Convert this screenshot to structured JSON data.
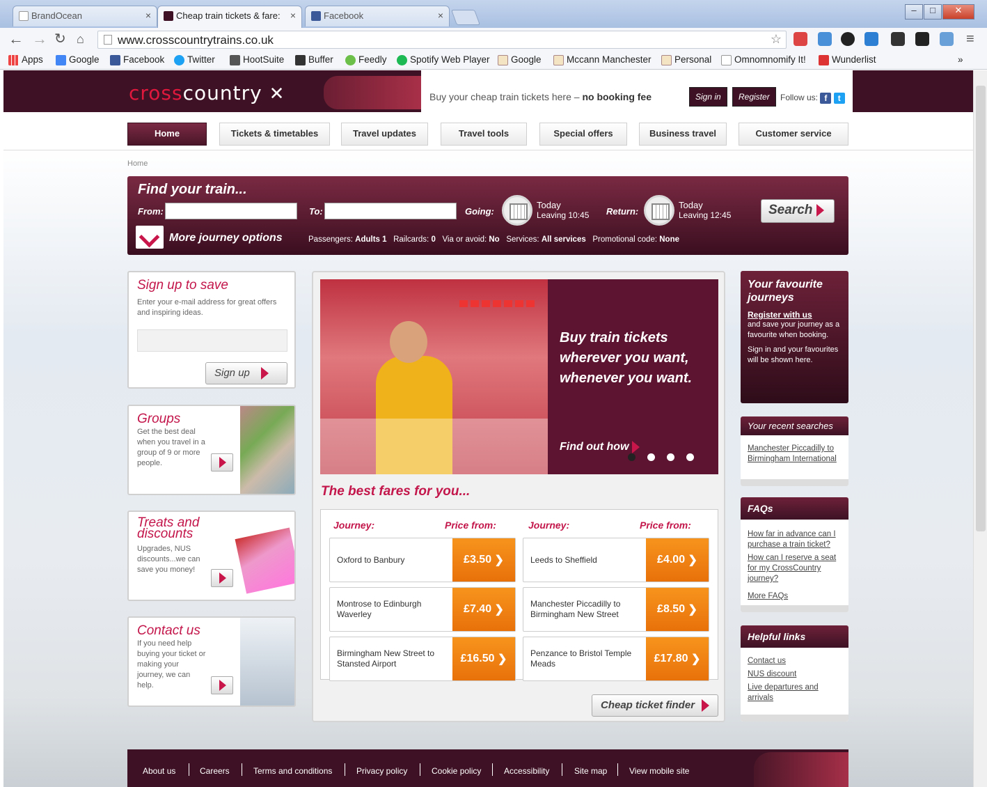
{
  "browser": {
    "tabs": [
      {
        "label": "BrandOcean"
      },
      {
        "label": "Cheap train tickets & fare:"
      },
      {
        "label": "Facebook"
      }
    ],
    "url": "www.crosscountrytrains.co.uk",
    "bookmarks": [
      "Apps",
      "Google",
      "Facebook",
      "Twitter",
      "HootSuite",
      "Buffer",
      "Feedly",
      "Spotify Web Player",
      "Google",
      "Mccann Manchester",
      "Personal",
      "Omnomnomify It!",
      "Wunderlist"
    ],
    "bookmarks_more": "»",
    "window_buttons": [
      "–",
      "□",
      "✕"
    ]
  },
  "header": {
    "logo_part1": "cross",
    "logo_part2": "country",
    "tagline_prefix": "Buy your cheap train tickets here –",
    "tagline_bold": "no booking fee",
    "sign_in": "Sign in",
    "register": "Register",
    "follow_us": "Follow us:"
  },
  "nav": [
    "Home",
    "Tickets & timetables",
    "Travel updates",
    "Travel tools",
    "Special offers",
    "Business travel",
    "Customer service"
  ],
  "breadcrumb": "Home",
  "finder": {
    "title": "Find your train...",
    "from_label": "From:",
    "to_label": "To:",
    "going_label": "Going:",
    "going_day": "Today",
    "going_time": "Leaving 10:45",
    "return_label": "Return:",
    "return_day": "Today",
    "return_time": "Leaving 12:45",
    "search": "Search",
    "more_options": "More journey options",
    "options": [
      {
        "label": "Passengers:",
        "value": "Adults 1"
      },
      {
        "label": "Railcards:",
        "value": "0"
      },
      {
        "label": "Via or avoid:",
        "value": "No"
      },
      {
        "label": "Services:",
        "value": "All services"
      },
      {
        "label": "Promotional code:",
        "value": "None"
      }
    ]
  },
  "left": {
    "signup": {
      "title": "Sign up to save",
      "text": "Enter your e-mail address for great offers and inspiring ideas.",
      "button": "Sign up"
    },
    "groups": {
      "title": "Groups",
      "text": "Get the best deal when you travel in a group of 9 or more people."
    },
    "treats": {
      "title": "Treats and discounts",
      "text": "Upgrades, NUS discounts...we can save you money!"
    },
    "contact": {
      "title": "Contact us",
      "text": "If you need help buying your ticket or making your journey, we can help."
    }
  },
  "hero": {
    "line1": "Buy train tickets",
    "line2": "wherever you want,",
    "line3": "whenever you want.",
    "find_out": "Find out how"
  },
  "fares": {
    "heading": "The best fares for you...",
    "journey_label": "Journey:",
    "price_label": "Price from:",
    "items": [
      {
        "route": "Oxford to Banbury",
        "price": "£3.50"
      },
      {
        "route": "Leeds to Sheffield",
        "price": "£4.00"
      },
      {
        "route": "Montrose to Edinburgh Waverley",
        "price": "£7.40"
      },
      {
        "route": "Manchester Piccadilly to Birmingham New Street",
        "price": "£8.50"
      },
      {
        "route": "Birmingham New Street to Stansted Airport",
        "price": "£16.50"
      },
      {
        "route": "Penzance to Bristol Temple Meads",
        "price": "£17.80"
      }
    ],
    "cheap_finder": "Cheap ticket finder"
  },
  "right": {
    "favourites": {
      "title": "Your favourite journeys",
      "register": "Register with us",
      "text1": "and save your journey as a favourite when booking.",
      "text2": "Sign in and your favourites will be shown here."
    },
    "recent": {
      "title": "Your recent searches",
      "link": "Manchester Piccadilly to Birmingham International"
    },
    "faqs": {
      "title": "FAQs",
      "links": [
        "How far in advance can I purchase a train ticket?",
        "How can I reserve a seat for my CrossCountry journey?",
        "More FAQs"
      ]
    },
    "helpful": {
      "title": "Helpful links",
      "links": [
        "Contact us",
        "NUS discount",
        "Live departures and arrivals"
      ]
    }
  },
  "footer": [
    "About us",
    "Careers",
    "Terms and conditions",
    "Privacy policy",
    "Cookie policy",
    "Accessibility",
    "Site map",
    "View mobile site"
  ]
}
